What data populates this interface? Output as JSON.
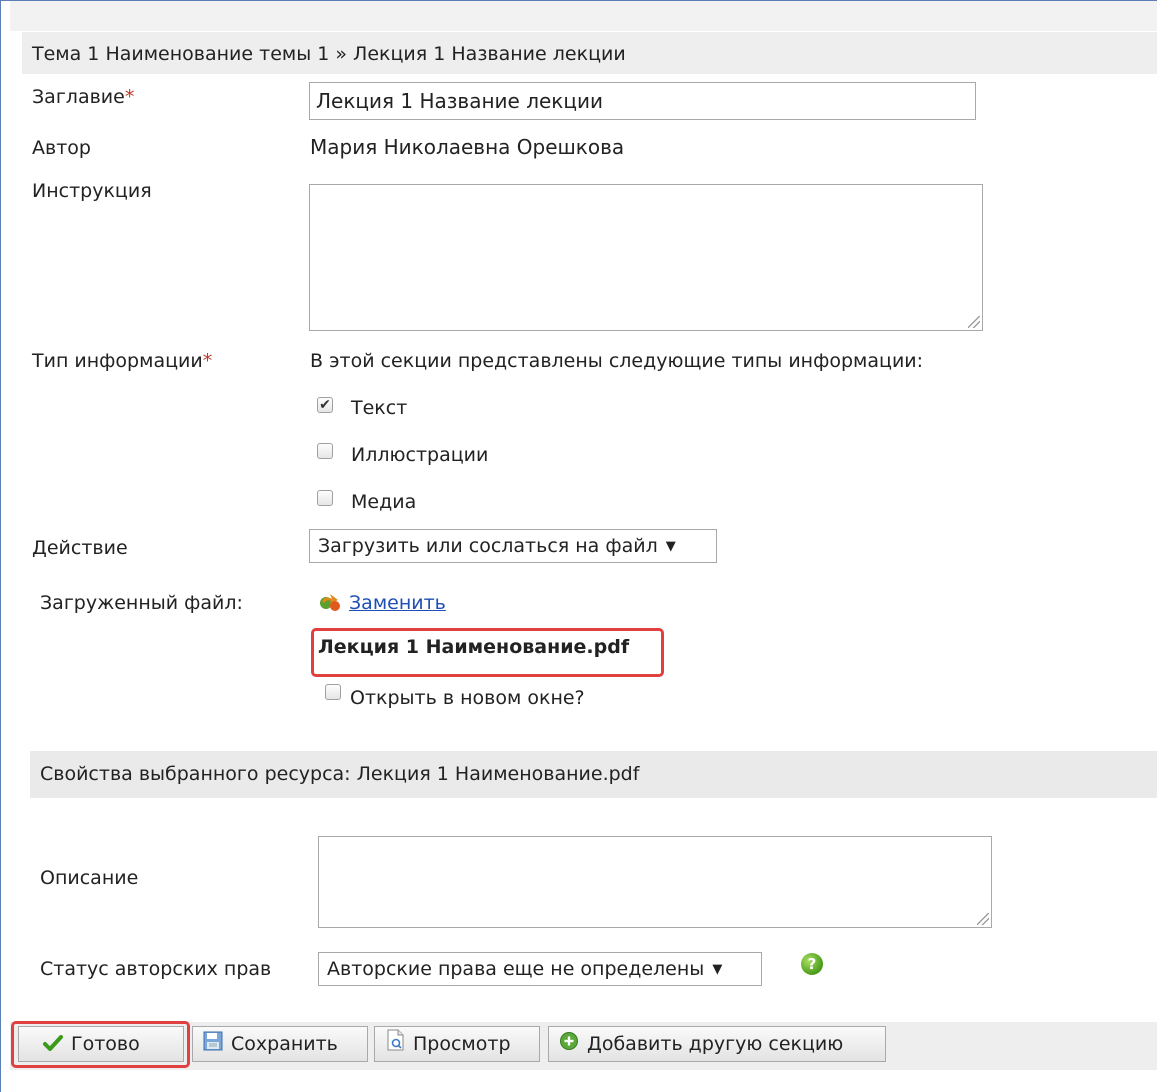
{
  "breadcrumb": "Тема 1 Наименование темы 1 » Лекция 1 Название лекции",
  "title_field": {
    "label": "Заглавие",
    "required_mark": "*",
    "value": "Лекция 1 Название лекции"
  },
  "author": {
    "label": "Автор",
    "value": "Мария Николаевна Орешкова"
  },
  "instruction": {
    "label": "Инструкция",
    "value": ""
  },
  "info_type": {
    "label": "Тип информации",
    "required_mark": "*",
    "intro": "В этой секции представлены следующие типы информации:",
    "options": [
      {
        "label": "Текст",
        "checked": true
      },
      {
        "label": "Иллюстрации",
        "checked": false
      },
      {
        "label": "Медиа",
        "checked": false
      }
    ]
  },
  "action": {
    "label": "Действие",
    "selected": "Загрузить или сослаться на файл",
    "arrow": "▼"
  },
  "uploaded": {
    "label": "Загруженный файл:",
    "replace_link": "Заменить",
    "filename": "Лекция 1 Наименование.pdf",
    "open_new_window": {
      "label": "Открыть в новом окне?",
      "checked": false
    }
  },
  "properties": {
    "header": "Свойства выбранного ресурса: Лекция 1 Наименование.pdf",
    "description_label": "Описание",
    "description_value": "",
    "copyright_label": "Статус авторских прав",
    "copyright_selected": "Авторские права еще не определены",
    "copyright_arrow": "▼",
    "help_glyph": "?"
  },
  "toolbar": {
    "done": "Готово",
    "save": "Сохранить",
    "preview": "Просмотр",
    "add_section": "Добавить другую секцию"
  },
  "colors": {
    "highlight": "#e04040",
    "link": "#1e4fb4",
    "required": "#c0392b"
  }
}
